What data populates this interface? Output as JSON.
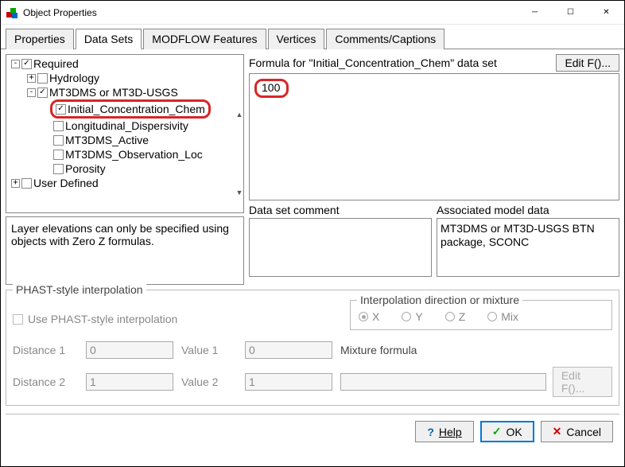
{
  "window": {
    "title": "Object Properties"
  },
  "tabs": [
    "Properties",
    "Data Sets",
    "MODFLOW Features",
    "Vertices",
    "Comments/Captions"
  ],
  "active_tab": 1,
  "tree": {
    "required": {
      "label": "Required",
      "checked": true,
      "expanded": true
    },
    "hydrology": {
      "label": "Hydrology",
      "checked": false,
      "expanded": false
    },
    "mt3": {
      "label": "MT3DMS or MT3D-USGS",
      "checked": true,
      "expanded": true
    },
    "children": [
      {
        "label": "Initial_Concentration_Chem",
        "checked": true
      },
      {
        "label": "Longitudinal_Dispersivity",
        "checked": false
      },
      {
        "label": "MT3DMS_Active",
        "checked": false
      },
      {
        "label": "MT3DMS_Observation_Loc",
        "checked": false
      },
      {
        "label": "Porosity",
        "checked": false
      }
    ],
    "user_defined": {
      "label": "User Defined",
      "checked": false,
      "expanded": false
    }
  },
  "info_text": "Layer elevations can only be specified using objects with Zero Z formulas.",
  "formula": {
    "label": "Formula for \"Initial_Concentration_Chem\" data set",
    "value": "100",
    "edit_btn": "Edit F()..."
  },
  "comment_label": "Data set comment",
  "assoc_label": "Associated model data",
  "assoc_text": "MT3DMS or MT3D-USGS BTN package, SCONC",
  "phast": {
    "title": "PHAST-style interpolation",
    "use_label": "Use PHAST-style interpolation",
    "interp_title": "Interpolation direction or mixture",
    "radios": [
      "X",
      "Y",
      "Z",
      "Mix"
    ],
    "dist1_label": "Distance 1",
    "dist1_val": "0",
    "val1_label": "Value 1",
    "val1_val": "0",
    "dist2_label": "Distance 2",
    "dist2_val": "1",
    "val2_label": "Value 2",
    "val2_val": "1",
    "mixture_label": "Mixture formula",
    "editf": "Edit F()..."
  },
  "footer": {
    "help": "Help",
    "ok": "OK",
    "cancel": "Cancel"
  }
}
